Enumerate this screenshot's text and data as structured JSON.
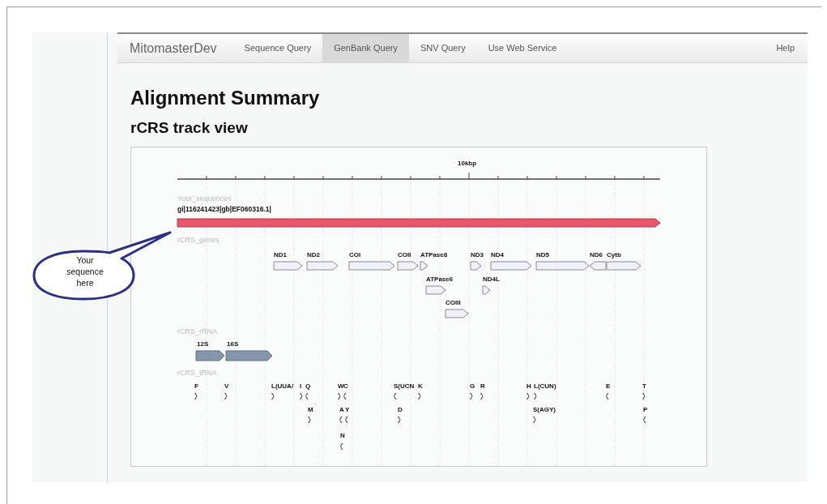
{
  "nav": {
    "brand": "MitomasterDev",
    "tabs": [
      {
        "label": "Sequence Query",
        "selected": false
      },
      {
        "label": "GenBank Query",
        "selected": true
      },
      {
        "label": "SNV Query",
        "selected": false
      },
      {
        "label": "Use Web Service",
        "selected": false
      }
    ],
    "help": "Help"
  },
  "title": "Alignment Summary",
  "subtitle": "rCRS track view",
  "track_view": {
    "scale_label": "10kbp",
    "tracks": [
      {
        "kind": "sequence",
        "name": "Your_sequences",
        "features": [
          {
            "label": "gi|116241423|gb|EF060316.1|",
            "reverse": false
          }
        ]
      },
      {
        "kind": "gene",
        "name": "rCRS_genes",
        "features": [
          {
            "label": "ND1",
            "reverse": false
          },
          {
            "label": "ND2",
            "reverse": false
          },
          {
            "label": "COI",
            "reverse": false
          },
          {
            "label": "COII",
            "reverse": false
          },
          {
            "label": "ATPase8",
            "reverse": false
          },
          {
            "label": "ATPase6",
            "reverse": false
          },
          {
            "label": "COIII",
            "reverse": false
          },
          {
            "label": "ND3",
            "reverse": false
          },
          {
            "label": "ND4",
            "reverse": false
          },
          {
            "label": "ND4L",
            "reverse": false
          },
          {
            "label": "ND5",
            "reverse": false
          },
          {
            "label": "ND6",
            "reverse": true
          },
          {
            "label": "Cytb",
            "reverse": false
          }
        ]
      },
      {
        "kind": "rrna",
        "name": "rCRS_rRNA",
        "features": [
          {
            "label": "12S",
            "reverse": false
          },
          {
            "label": "16S",
            "reverse": false
          }
        ]
      },
      {
        "kind": "trna",
        "name": "rCRS_tRNA",
        "features": [
          {
            "label": "F",
            "reverse": false
          },
          {
            "label": "V",
            "reverse": false
          },
          {
            "label": "L(UUA/",
            "reverse": false
          },
          {
            "label": "I",
            "reverse": false
          },
          {
            "label": "Q",
            "reverse": true
          },
          {
            "label": "M",
            "reverse": false
          },
          {
            "label": "W",
            "reverse": false
          },
          {
            "label": "C",
            "reverse": true
          },
          {
            "label": "A",
            "reverse": true
          },
          {
            "label": "Y",
            "reverse": true
          },
          {
            "label": "N",
            "reverse": true
          },
          {
            "label": "S(UCN",
            "reverse": true
          },
          {
            "label": "K",
            "reverse": false
          },
          {
            "label": "D",
            "reverse": false
          },
          {
            "label": "G",
            "reverse": false
          },
          {
            "label": "R",
            "reverse": false
          },
          {
            "label": "H",
            "reverse": false
          },
          {
            "label": "L(CUN)",
            "reverse": false
          },
          {
            "label": "S(AGY)",
            "reverse": false
          },
          {
            "label": "E",
            "reverse": true
          },
          {
            "label": "T",
            "reverse": false
          },
          {
            "label": "P",
            "reverse": true
          }
        ]
      }
    ]
  },
  "callout": {
    "text": "Your sequence here"
  }
}
